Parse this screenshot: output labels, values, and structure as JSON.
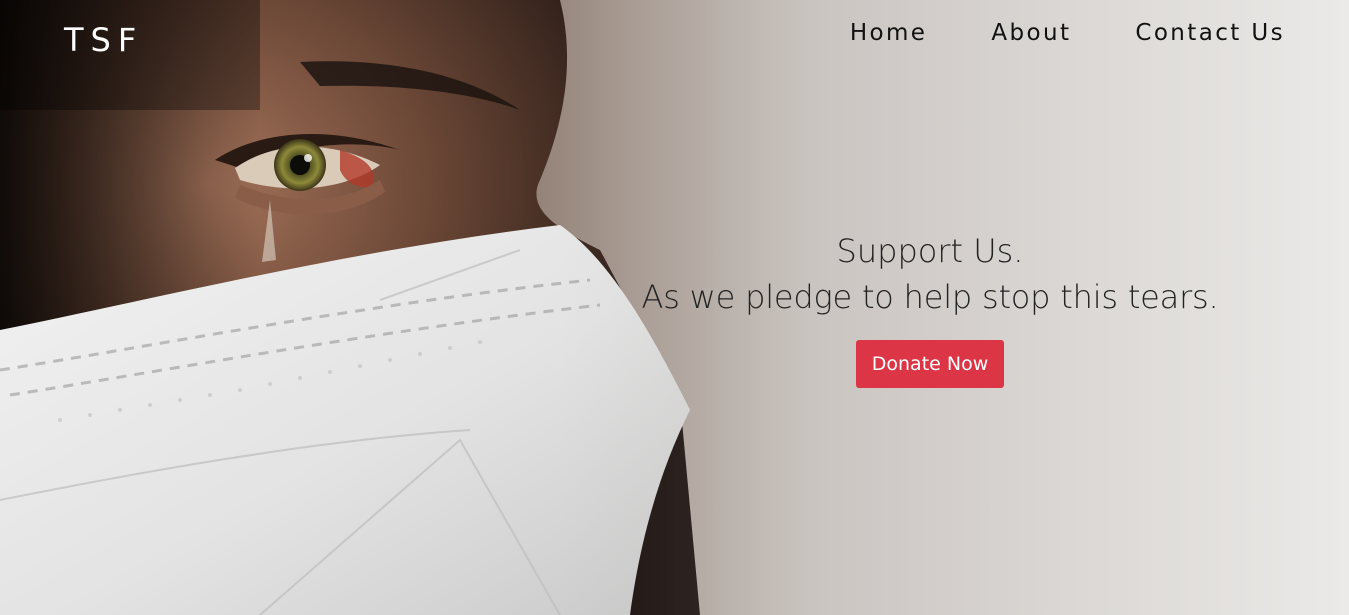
{
  "brand": {
    "name": "TSF"
  },
  "nav": {
    "items": [
      {
        "label": "Home"
      },
      {
        "label": "About"
      },
      {
        "label": "Contact Us"
      }
    ]
  },
  "hero": {
    "headline": "Support Us.",
    "subline": "As we pledge to help stop this tears.",
    "cta_label": "Donate Now",
    "image": "person-with-tearful-eye-wearing-face-mask",
    "colors": {
      "cta_background": "#dc3545",
      "cta_text": "#ffffff",
      "text": "#222222",
      "brand_text": "#ffffff"
    }
  }
}
